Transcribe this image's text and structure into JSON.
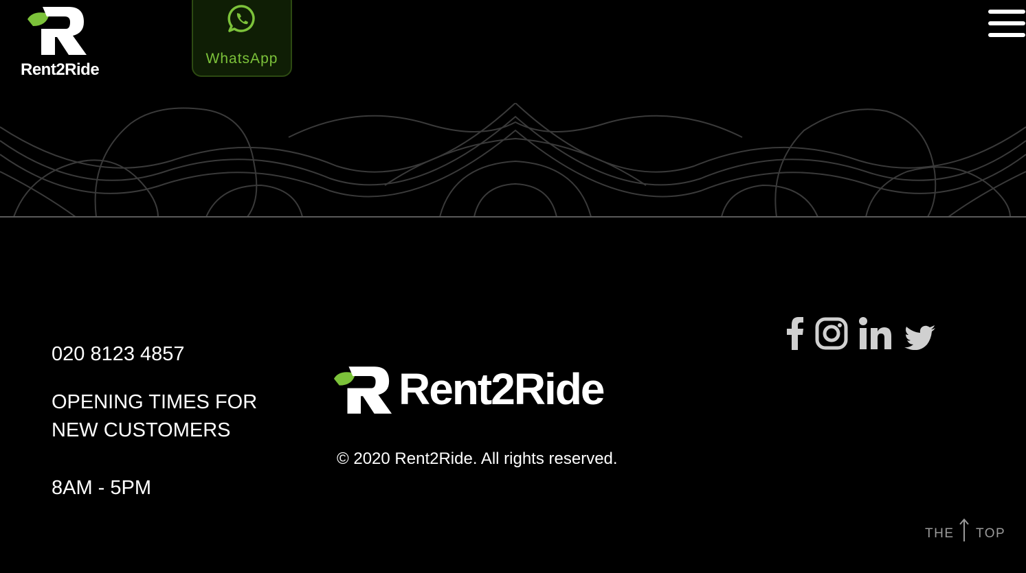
{
  "header": {
    "brand": "Rent2Ride",
    "whatsapp_label": "WhatsApp",
    "menu_icon": "hamburger-menu-icon"
  },
  "footer": {
    "phone": "020 8123 4857",
    "opening_title_line1": "OPENING TIMES FOR",
    "opening_title_line2": "NEW CUSTOMERS",
    "opening_hours": "8AM - 5PM",
    "brand": "Rent2Ride",
    "copyright": "© 2020 Rent2Ride. All rights reserved.",
    "socials": [
      "facebook-icon",
      "instagram-icon",
      "linkedin-icon",
      "twitter-icon"
    ],
    "back_to_top": {
      "left": "THE",
      "right": "TOP"
    }
  },
  "colors": {
    "background": "#000000",
    "accent_green": "#7cc23a",
    "whatsapp_bg": "#0f1e05",
    "icon_gray": "#d0d0d0",
    "muted_text": "#9a9a9a"
  }
}
